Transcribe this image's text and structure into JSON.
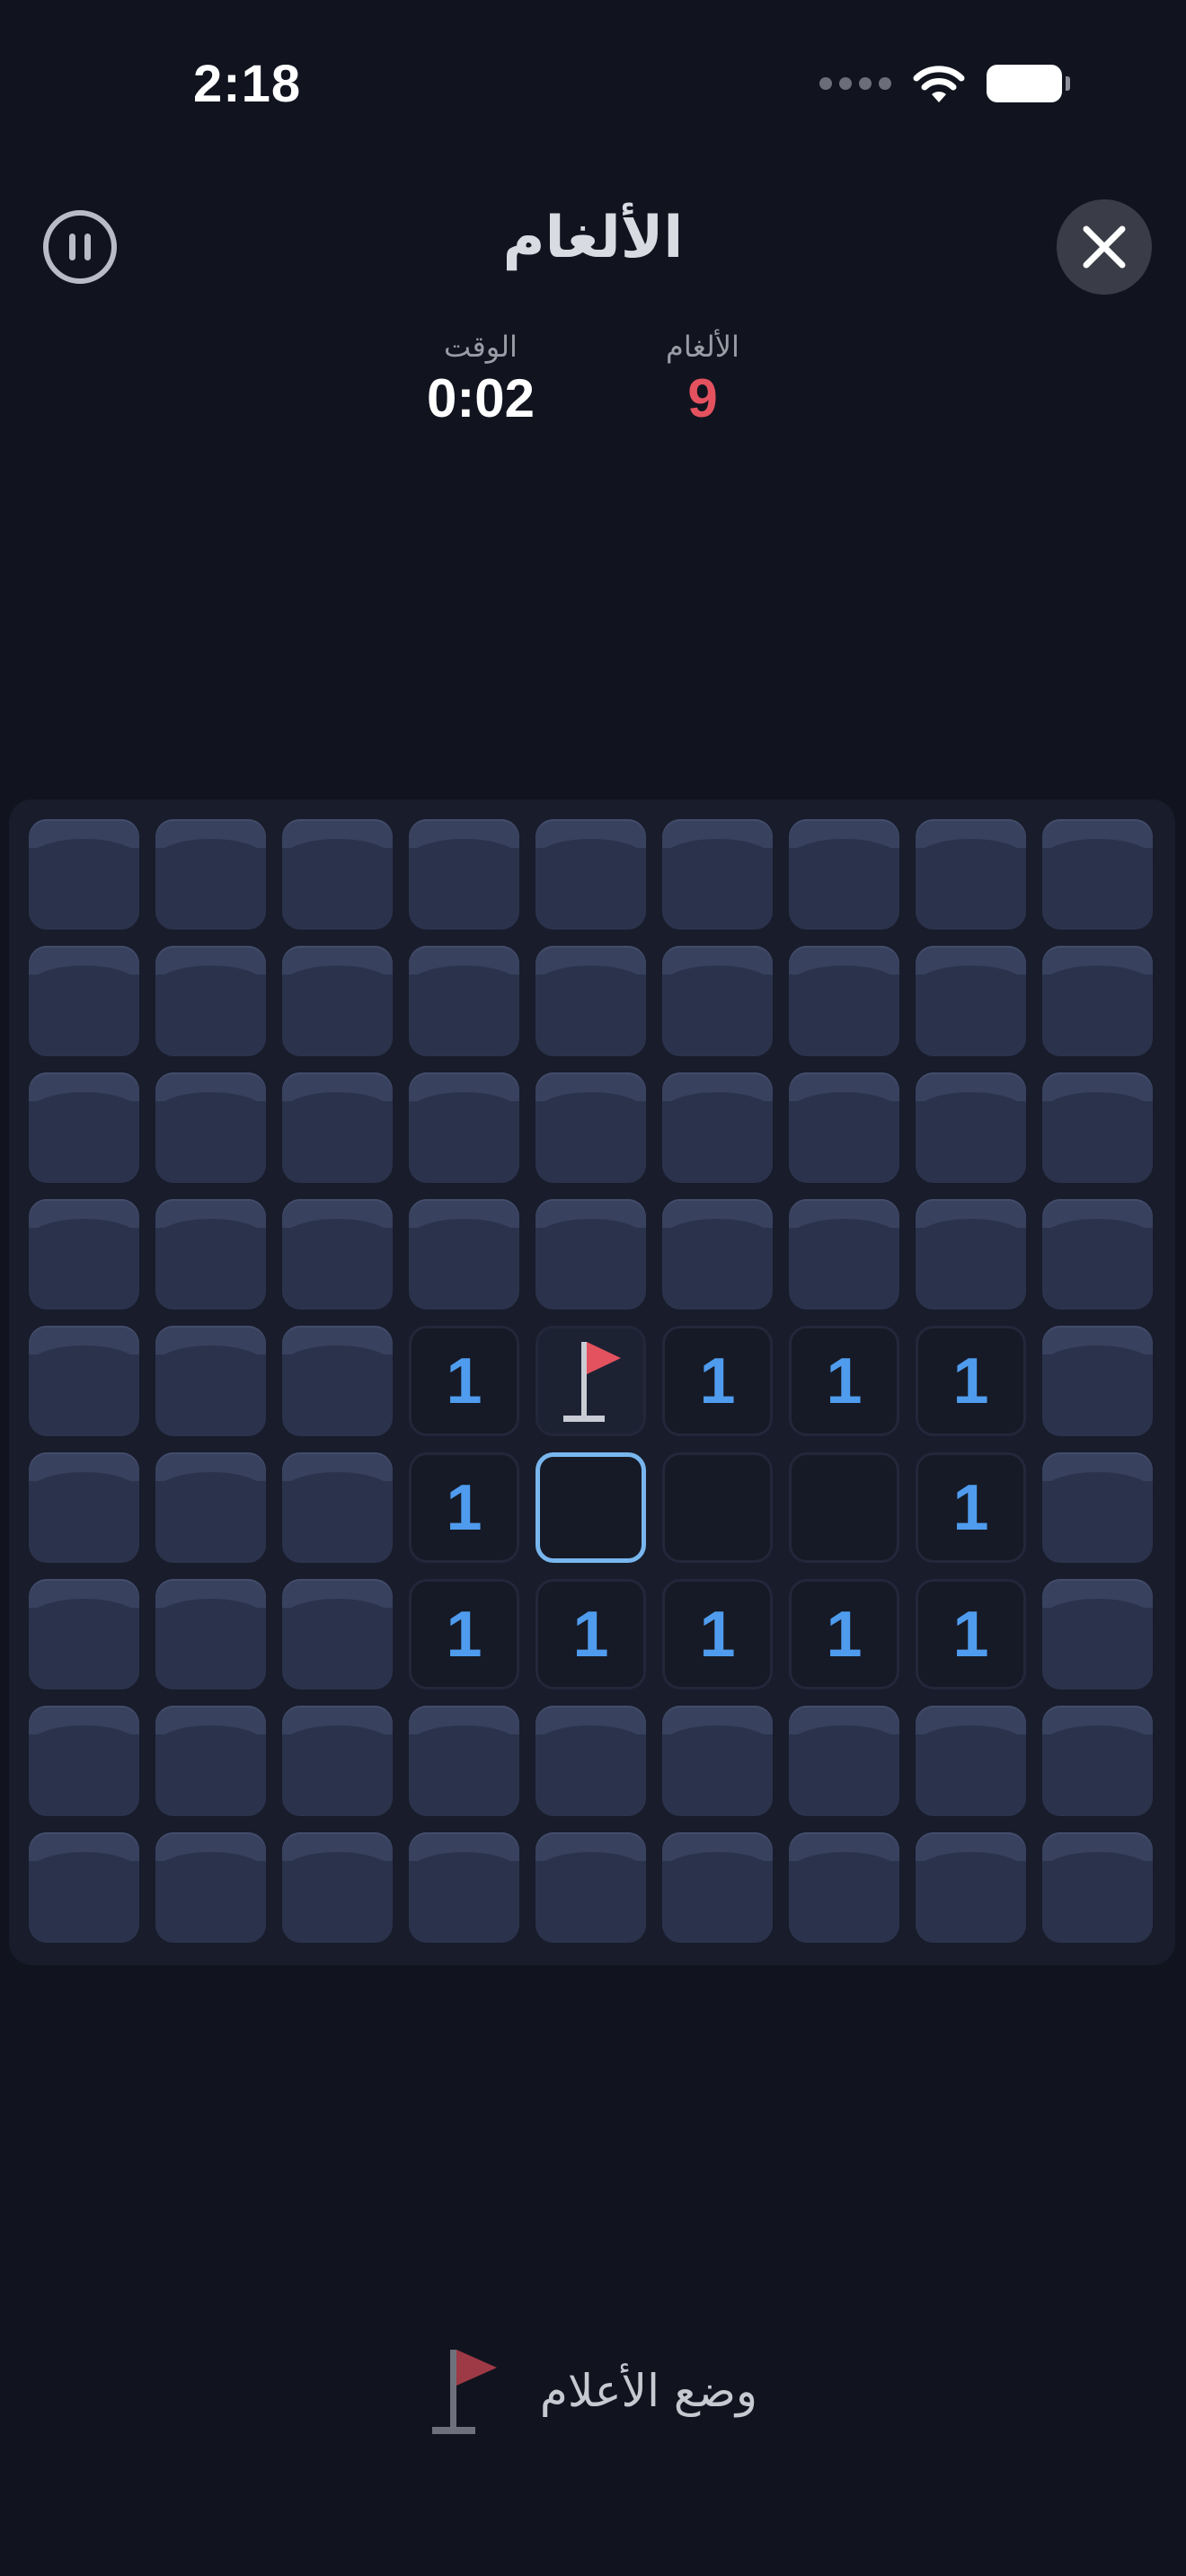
{
  "status_bar": {
    "time": "2:18"
  },
  "header": {
    "title": "الألغام",
    "pause_icon": "pause-circle-icon",
    "close_icon": "close-icon"
  },
  "stats": {
    "time_label": "الوقت",
    "time_value": "0:02",
    "mines_label": "الألغام",
    "mines_value": "9"
  },
  "board": {
    "rows": 9,
    "cols": 9,
    "cells": [
      [
        "c",
        "c",
        "c",
        "c",
        "c",
        "c",
        "c",
        "c",
        "c"
      ],
      [
        "c",
        "c",
        "c",
        "c",
        "c",
        "c",
        "c",
        "c",
        "c"
      ],
      [
        "c",
        "c",
        "c",
        "c",
        "c",
        "c",
        "c",
        "c",
        "c"
      ],
      [
        "c",
        "c",
        "c",
        "c",
        "c",
        "c",
        "c",
        "c",
        "c"
      ],
      [
        "c",
        "c",
        "c",
        "1",
        "F",
        "1",
        "1",
        "1",
        "c"
      ],
      [
        "c",
        "c",
        "c",
        "1",
        "S",
        "0",
        "0",
        "1",
        "c"
      ],
      [
        "c",
        "c",
        "c",
        "1",
        "1",
        "1",
        "1",
        "1",
        "c"
      ],
      [
        "c",
        "c",
        "c",
        "c",
        "c",
        "c",
        "c",
        "c",
        "c"
      ],
      [
        "c",
        "c",
        "c",
        "c",
        "c",
        "c",
        "c",
        "c",
        "c"
      ]
    ]
  },
  "flag_mode": {
    "label": "وضع الأعلام",
    "icon": "flag-icon"
  },
  "colors": {
    "background": "#11141f",
    "number": "#4f9cee",
    "mines_counter": "#e5525f",
    "flag": "#e5525f",
    "selected_border": "#79b6ee"
  }
}
